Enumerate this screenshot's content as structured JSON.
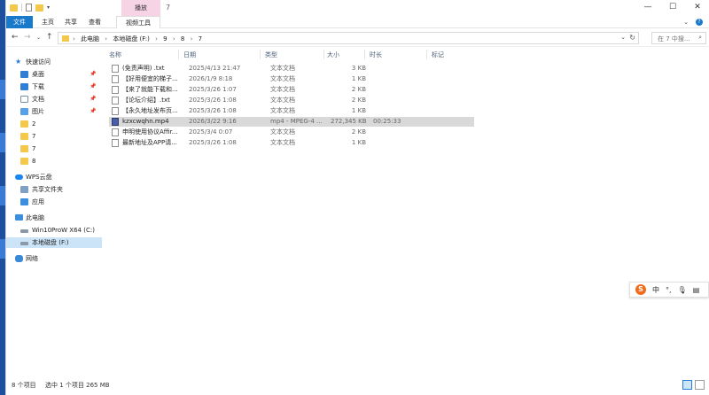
{
  "window": {
    "title": "7",
    "contextual_tab": "播放",
    "controls": [
      "—",
      "☐",
      "✕"
    ]
  },
  "ribbon": {
    "tabs": [
      "文件",
      "主页",
      "共享",
      "查看",
      "视频工具"
    ],
    "help": "?"
  },
  "address": {
    "crumbs": [
      "此电脑",
      "本地磁盘 (F:)",
      "9",
      "8",
      "7"
    ],
    "search_placeholder": "在 7 中搜..."
  },
  "navigation": {
    "quick_access": "快速访问",
    "quick_items": [
      {
        "label": "桌面",
        "pinned": true
      },
      {
        "label": "下载",
        "pinned": true
      },
      {
        "label": "文档",
        "pinned": true
      },
      {
        "label": "图片",
        "pinned": true
      },
      {
        "label": "2",
        "pinned": false
      },
      {
        "label": "7",
        "pinned": false
      },
      {
        "label": "7",
        "pinned": false
      },
      {
        "label": "8",
        "pinned": false
      }
    ],
    "wps_cloud": "WPS云盘",
    "wps_items": [
      "共享文件夹",
      "应用"
    ],
    "this_pc": "此电脑",
    "drives": [
      "Win10ProW X64 (C:)",
      "本地磁盘 (F:)"
    ],
    "network": "网络"
  },
  "columns": {
    "name": "名称",
    "date": "日期",
    "type": "类型",
    "size": "大小",
    "length": "时长",
    "tags": "标记"
  },
  "files": [
    {
      "name": "(免责声明) .txt",
      "date": "2025/4/13 21:47",
      "type": "文本文档",
      "size": "3 KB",
      "length": "",
      "video": false,
      "selected": false
    },
    {
      "name": "【好用便宜的梯子...",
      "date": "2026/1/9 8:18",
      "type": "文本文档",
      "size": "1 KB",
      "length": "",
      "video": false,
      "selected": false
    },
    {
      "name": "【来了就能下载和...",
      "date": "2025/3/26 1:07",
      "type": "文本文档",
      "size": "2 KB",
      "length": "",
      "video": false,
      "selected": false
    },
    {
      "name": "【论坛介绍】.txt",
      "date": "2025/3/26 1:08",
      "type": "文本文档",
      "size": "2 KB",
      "length": "",
      "video": false,
      "selected": false
    },
    {
      "name": "【永久地址发布页...",
      "date": "2025/3/26 1:08",
      "type": "文本文档",
      "size": "1 KB",
      "length": "",
      "video": false,
      "selected": false
    },
    {
      "name": "kzxcwqhn.mp4",
      "date": "2026/3/22 9:16",
      "type": "mp4 - MPEG-4 ...",
      "size": "272,345 KB",
      "length": "00:25:33",
      "video": true,
      "selected": true
    },
    {
      "name": "申明使用协议Affir...",
      "date": "2025/3/4 0:07",
      "type": "文本文档",
      "size": "2 KB",
      "length": "",
      "video": false,
      "selected": false
    },
    {
      "name": "最新地址及APP请...",
      "date": "2025/3/26 1:08",
      "type": "文本文档",
      "size": "1 KB",
      "length": "",
      "video": false,
      "selected": false
    }
  ],
  "status": {
    "count": "8 个项目",
    "selection": "选中 1 个项目  265 MB"
  },
  "ime": {
    "logo": "S",
    "lang": "中"
  }
}
